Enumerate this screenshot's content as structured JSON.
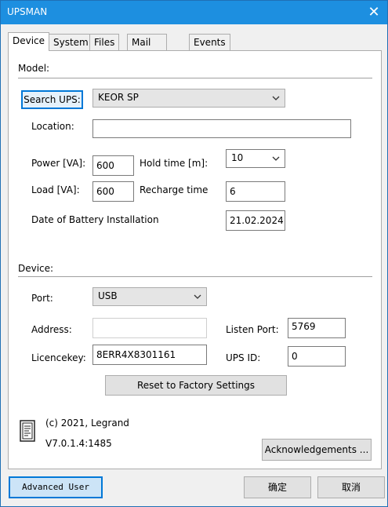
{
  "window": {
    "title": "UPSMAN",
    "close_glyph": "✕"
  },
  "tabs": [
    "Device",
    "System",
    "Files",
    "Mail Server",
    "Events"
  ],
  "model_section": {
    "heading": "Model:",
    "search_button": "Search UPS:",
    "ups_model": "KEOR SP",
    "location_label": "Location:",
    "location_value": "",
    "power_label": "Power [VA]:",
    "power_value": "600",
    "hold_time_label": "Hold time [m]:",
    "hold_time_value": "10",
    "load_label": "Load [VA]:",
    "load_value": "600",
    "recharge_label": "Recharge time",
    "recharge_value": "6",
    "battery_label": "Date of Battery Installation",
    "battery_value": "21.02.2024"
  },
  "device_section": {
    "heading": "Device:",
    "port_label": "Port:",
    "port_value": "USB",
    "address_label": "Address:",
    "address_value": "",
    "listen_port_label": "Listen Port:",
    "listen_port_value": "5769",
    "licencekey_label": "Licencekey:",
    "licencekey_value": "8ERR4X8301161",
    "ups_id_label": "UPS ID:",
    "ups_id_value": "0",
    "reset_button": "Reset to Factory Settings"
  },
  "about": {
    "copyright": "(c) 2021, Legrand",
    "version": "V7.0.1.4:1485",
    "ack_button": "Acknowledgements ..."
  },
  "footer": {
    "advanced_button": "Advanced User",
    "ok_button": "确定",
    "cancel_button": "取消"
  }
}
